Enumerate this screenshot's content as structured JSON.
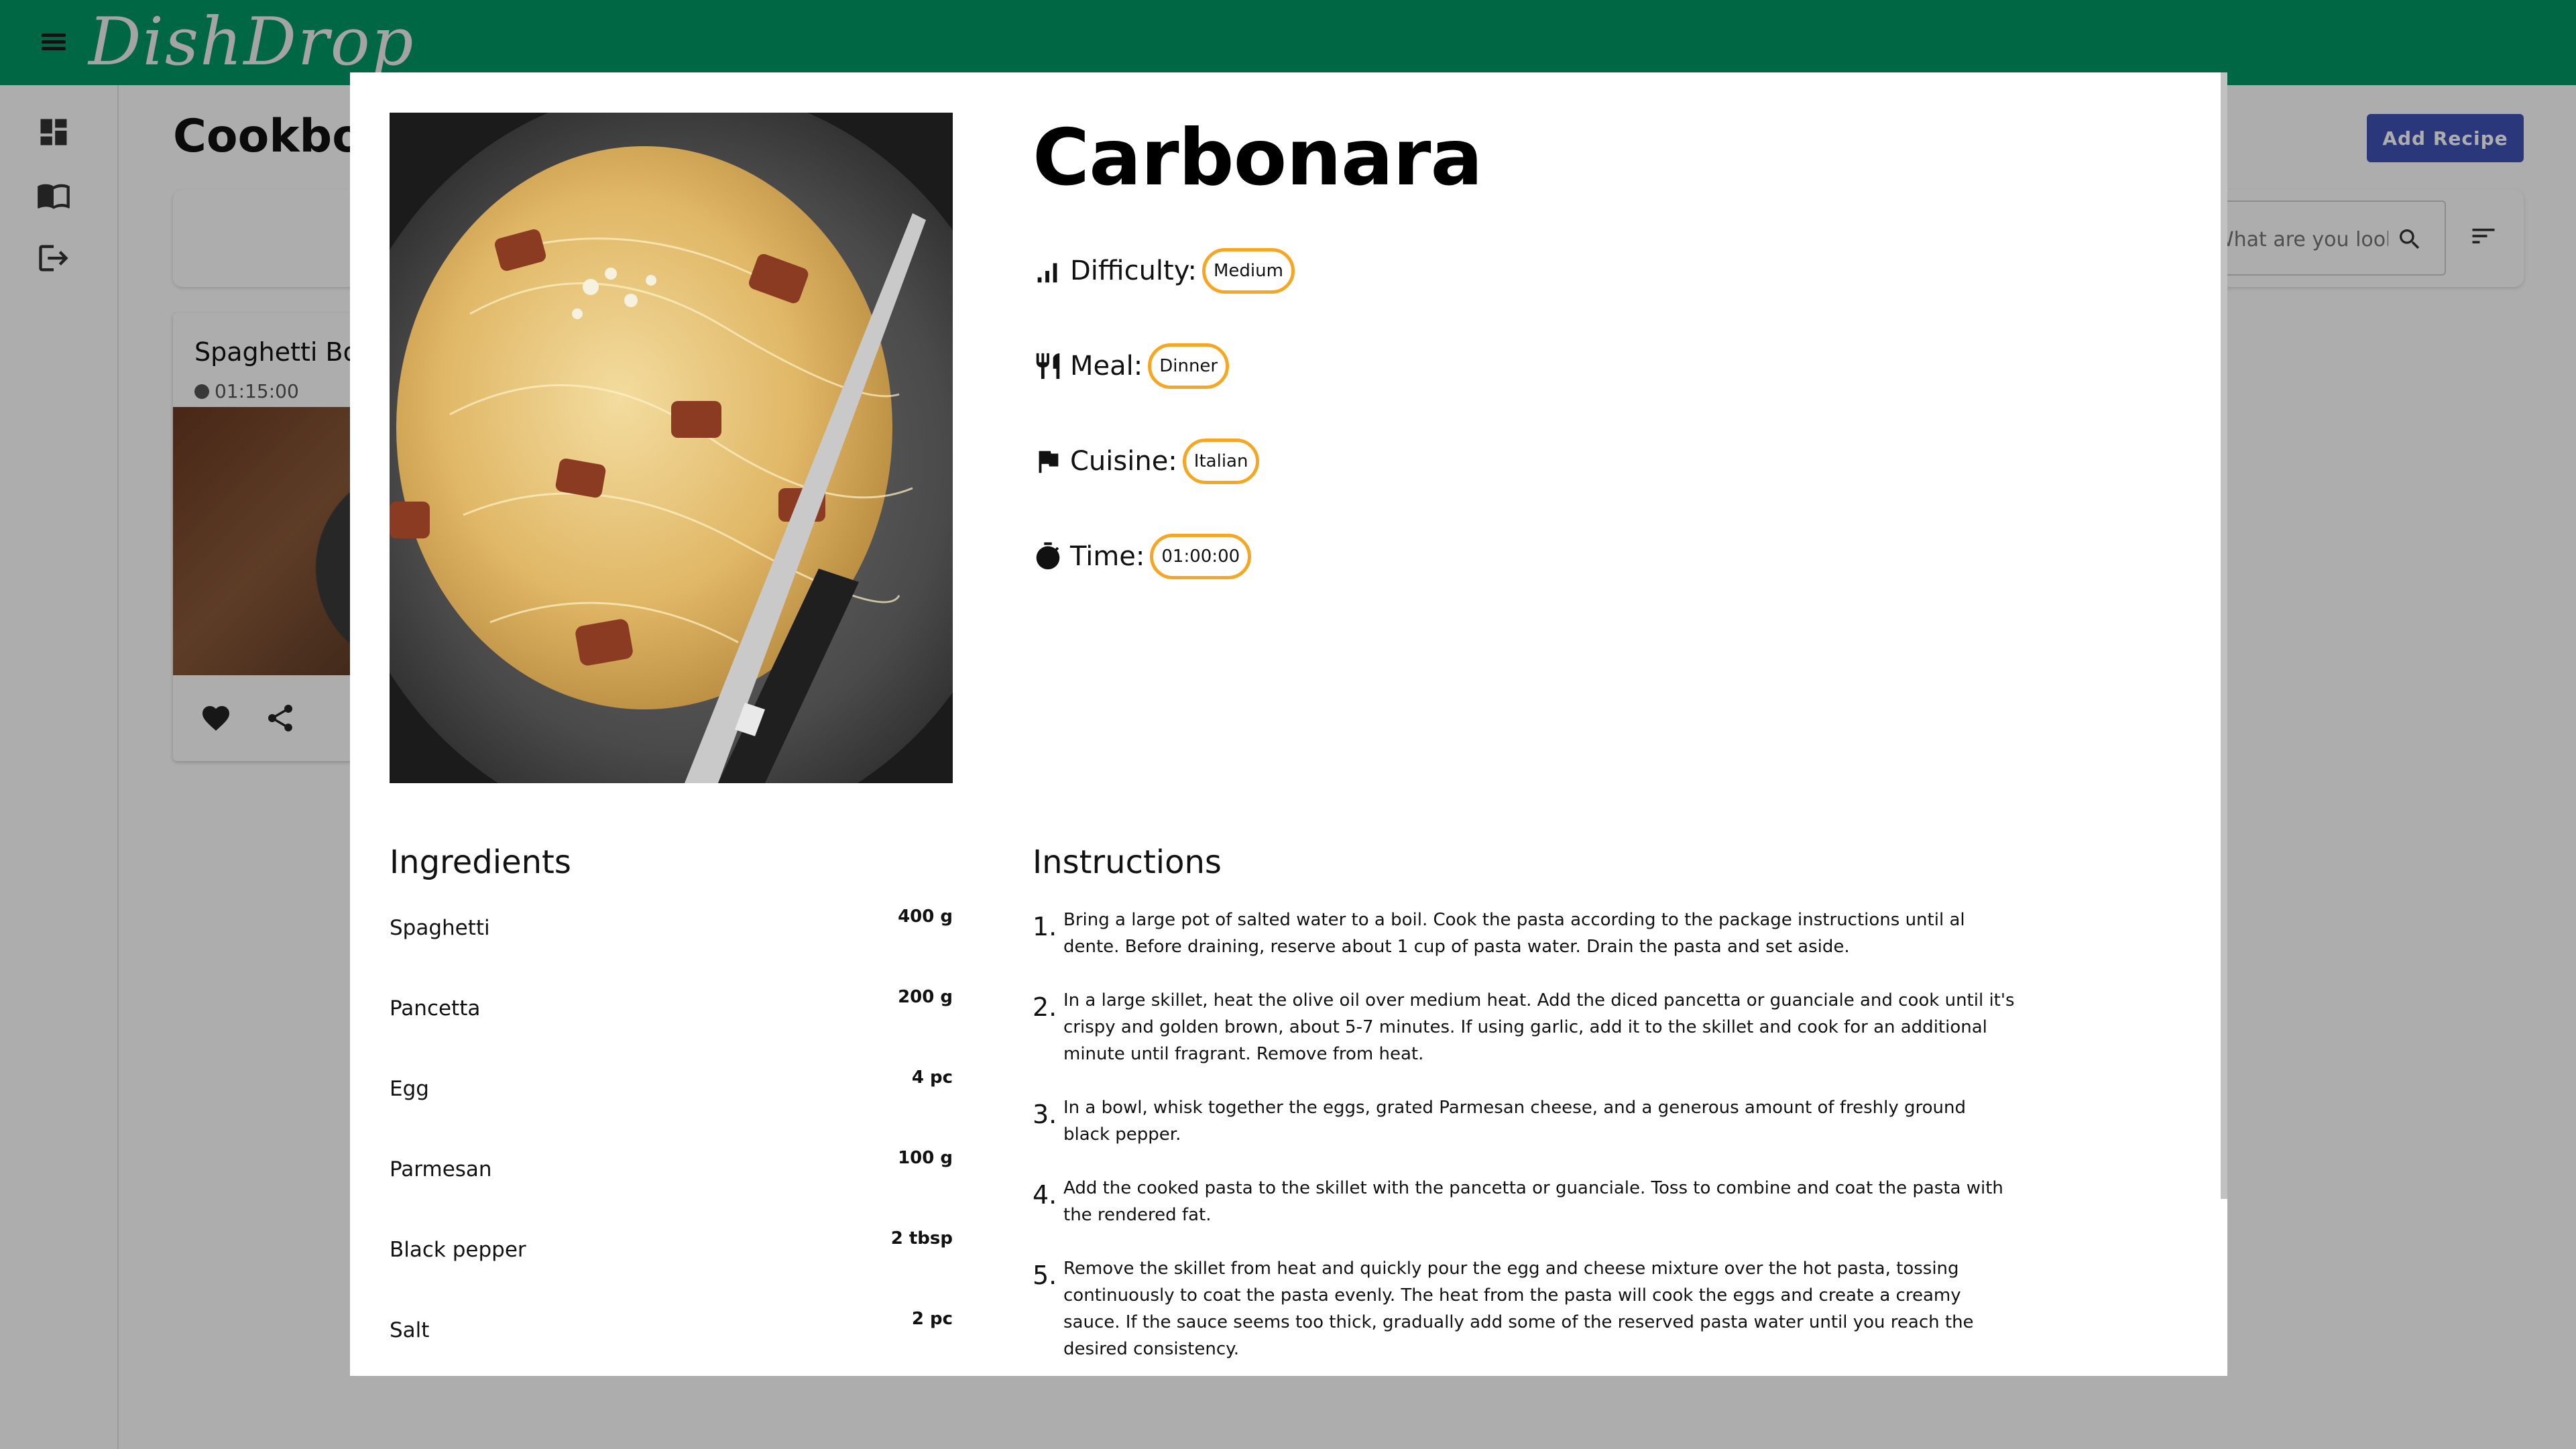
{
  "app": {
    "brand": "DishDrop"
  },
  "sidebar": {
    "items": [
      {
        "name": "dashboard",
        "icon": "dashboard-icon"
      },
      {
        "name": "cookbook",
        "icon": "book-icon"
      },
      {
        "name": "logout",
        "icon": "logout-icon"
      }
    ]
  },
  "page": {
    "title": "Cookbook",
    "add_recipe_label": "Add Recipe",
    "search_placeholder": "What are you looking for?",
    "search_icon": "search-icon",
    "sort_icon": "sort-icon"
  },
  "card": {
    "title": "Spaghetti Bolognese",
    "time": "01:15:00",
    "favorite_icon": "heart-icon",
    "share_icon": "share-icon"
  },
  "modal": {
    "title": "Carbonara",
    "meta": [
      {
        "label": "Difficulty:",
        "value": "Medium",
        "icon": "difficulty-bars-icon"
      },
      {
        "label": "Meal:",
        "value": "Dinner",
        "icon": "utensils-icon"
      },
      {
        "label": "Cuisine:",
        "value": "Italian",
        "icon": "flag-icon"
      },
      {
        "label": "Time:",
        "value": "01:00:00",
        "icon": "stopwatch-icon"
      }
    ],
    "ingredients_heading": "Ingredients",
    "ingredients": [
      {
        "name": "Spaghetti",
        "qty": "400 g"
      },
      {
        "name": "Pancetta",
        "qty": "200 g"
      },
      {
        "name": "Egg",
        "qty": "4 pc"
      },
      {
        "name": "Parmesan",
        "qty": "100 g"
      },
      {
        "name": "Black pepper",
        "qty": "2 tbsp"
      },
      {
        "name": "Salt",
        "qty": "2 pc"
      }
    ],
    "instructions_heading": "Instructions",
    "instructions": [
      {
        "num": "1.",
        "text": "Bring a large pot of salted water to a boil. Cook the pasta according to the package instructions until al dente. Before draining, reserve about 1 cup of pasta water. Drain the pasta and set aside."
      },
      {
        "num": "2.",
        "text": "In a large skillet, heat the olive oil over medium heat. Add the diced pancetta or guanciale and cook until it's crispy and golden brown, about 5-7 minutes. If using garlic, add it to the skillet and cook for an additional minute until fragrant. Remove from heat."
      },
      {
        "num": "3.",
        "text": "In a bowl, whisk together the eggs, grated Parmesan cheese, and a generous amount of freshly ground black pepper."
      },
      {
        "num": "4.",
        "text": "Add the cooked pasta to the skillet with the pancetta or guanciale. Toss to combine and coat the pasta with the rendered fat."
      },
      {
        "num": "5.",
        "text": "Remove the skillet from heat and quickly pour the egg and cheese mixture over the hot pasta, tossing continuously to coat the pasta evenly. The heat from the pasta will cook the eggs and create a creamy sauce. If the sauce seems too thick, gradually add some of the reserved pasta water until you reach the desired consistency."
      }
    ]
  },
  "colors": {
    "topbar": "#009865",
    "accent_button": "#3f51b5",
    "chip_border": "#f5a623"
  }
}
